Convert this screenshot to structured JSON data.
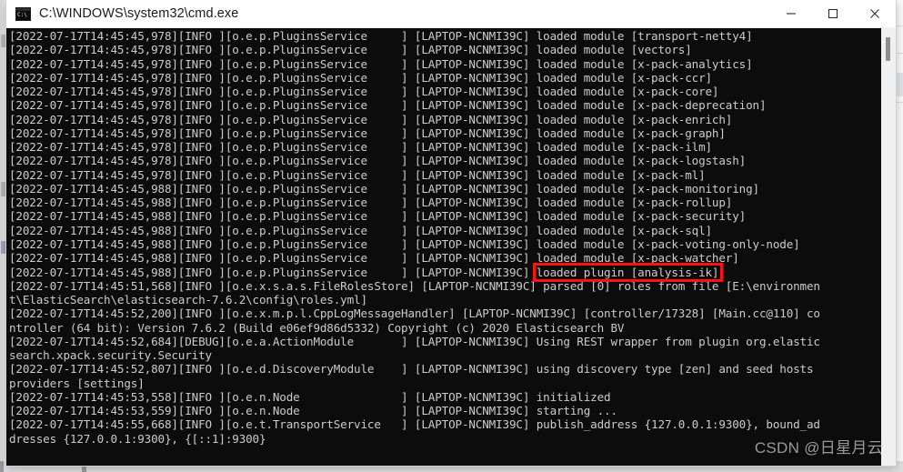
{
  "window": {
    "title": "C:\\WINDOWS\\system32\\cmd.exe",
    "icon": "cmd-console-icon",
    "icon_glyph": "C:\\",
    "buttons": {
      "minimize": "minimize-button",
      "maximize": "maximize-button",
      "close": "close-button"
    }
  },
  "scrollbar": {
    "name": "vertical-scrollbar",
    "thumb": "scrollbar-thumb"
  },
  "annotation": {
    "color": "#fb1412",
    "target_line_text": "loaded plugin [analysis-ik]"
  },
  "watermark": {
    "text": "CSDN @日星月云"
  },
  "console": {
    "background": "#0c0c0c",
    "foreground": "#cccccc",
    "lines": [
      "[2022-07-17T14:45:45,978][INFO ][o.e.p.PluginsService     ] [LAPTOP-NCNMI39C] loaded module [transport-netty4]",
      "[2022-07-17T14:45:45,978][INFO ][o.e.p.PluginsService     ] [LAPTOP-NCNMI39C] loaded module [vectors]",
      "[2022-07-17T14:45:45,978][INFO ][o.e.p.PluginsService     ] [LAPTOP-NCNMI39C] loaded module [x-pack-analytics]",
      "[2022-07-17T14:45:45,978][INFO ][o.e.p.PluginsService     ] [LAPTOP-NCNMI39C] loaded module [x-pack-ccr]",
      "[2022-07-17T14:45:45,978][INFO ][o.e.p.PluginsService     ] [LAPTOP-NCNMI39C] loaded module [x-pack-core]",
      "[2022-07-17T14:45:45,978][INFO ][o.e.p.PluginsService     ] [LAPTOP-NCNMI39C] loaded module [x-pack-deprecation]",
      "[2022-07-17T14:45:45,978][INFO ][o.e.p.PluginsService     ] [LAPTOP-NCNMI39C] loaded module [x-pack-enrich]",
      "[2022-07-17T14:45:45,978][INFO ][o.e.p.PluginsService     ] [LAPTOP-NCNMI39C] loaded module [x-pack-graph]",
      "[2022-07-17T14:45:45,978][INFO ][o.e.p.PluginsService     ] [LAPTOP-NCNMI39C] loaded module [x-pack-ilm]",
      "[2022-07-17T14:45:45,978][INFO ][o.e.p.PluginsService     ] [LAPTOP-NCNMI39C] loaded module [x-pack-logstash]",
      "[2022-07-17T14:45:45,978][INFO ][o.e.p.PluginsService     ] [LAPTOP-NCNMI39C] loaded module [x-pack-ml]",
      "[2022-07-17T14:45:45,988][INFO ][o.e.p.PluginsService     ] [LAPTOP-NCNMI39C] loaded module [x-pack-monitoring]",
      "[2022-07-17T14:45:45,988][INFO ][o.e.p.PluginsService     ] [LAPTOP-NCNMI39C] loaded module [x-pack-rollup]",
      "[2022-07-17T14:45:45,988][INFO ][o.e.p.PluginsService     ] [LAPTOP-NCNMI39C] loaded module [x-pack-security]",
      "[2022-07-17T14:45:45,988][INFO ][o.e.p.PluginsService     ] [LAPTOP-NCNMI39C] loaded module [x-pack-sql]",
      "[2022-07-17T14:45:45,988][INFO ][o.e.p.PluginsService     ] [LAPTOP-NCNMI39C] loaded module [x-pack-voting-only-node]",
      "[2022-07-17T14:45:45,988][INFO ][o.e.p.PluginsService     ] [LAPTOP-NCNMI39C] loaded module [x-pack-watcher]",
      "[2022-07-17T14:45:45,988][INFO ][o.e.p.PluginsService     ] [LAPTOP-NCNMI39C] loaded plugin [analysis-ik]",
      "[2022-07-17T14:45:51,568][INFO ][o.e.x.s.a.s.FileRolesStore] [LAPTOP-NCNMI39C] parsed [0] roles from file [E:\\environmen",
      "t\\ElasticSearch\\elasticsearch-7.6.2\\config\\roles.yml]",
      "[2022-07-17T14:45:52,200][INFO ][o.e.x.m.p.l.CppLogMessageHandler] [LAPTOP-NCNMI39C] [controller/17328] [Main.cc@110] co",
      "ntroller (64 bit): Version 7.6.2 (Build e06ef9d86d5332) Copyright (c) 2020 Elasticsearch BV",
      "[2022-07-17T14:45:52,684][DEBUG][o.e.a.ActionModule       ] [LAPTOP-NCNMI39C] Using REST wrapper from plugin org.elastic",
      "search.xpack.security.Security",
      "[2022-07-17T14:45:52,807][INFO ][o.e.d.DiscoveryModule    ] [LAPTOP-NCNMI39C] using discovery type [zen] and seed hosts ",
      "providers [settings]",
      "[2022-07-17T14:45:53,558][INFO ][o.e.n.Node               ] [LAPTOP-NCNMI39C] initialized",
      "[2022-07-17T14:45:53,559][INFO ][o.e.n.Node               ] [LAPTOP-NCNMI39C] starting ...",
      "[2022-07-17T14:45:55,668][INFO ][o.e.t.TransportService   ] [LAPTOP-NCNMI39C] publish_address {127.0.0.1:9300}, bound_ad",
      "dresses {127.0.0.1:9300}, {[::1]:9300}"
    ]
  }
}
